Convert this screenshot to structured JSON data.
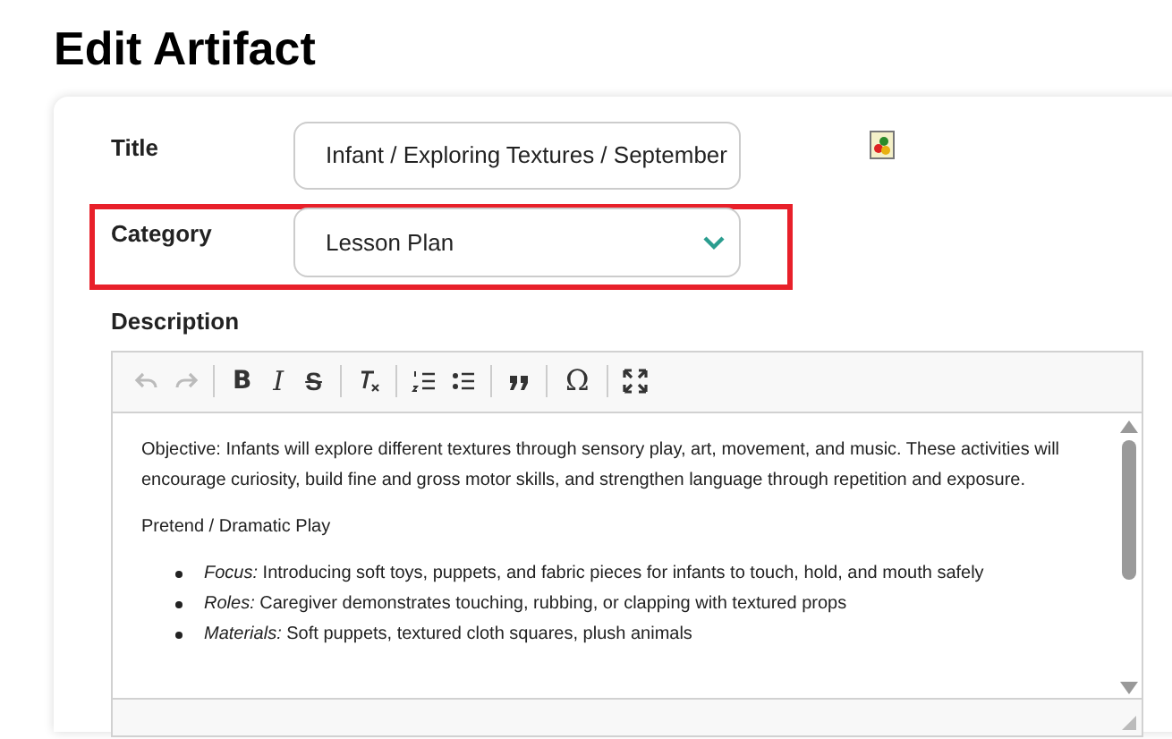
{
  "heading": "Edit Artifact",
  "fields": [
    {
      "kind": "text",
      "label": "Title",
      "value": "Infant / Exploring Textures / September",
      "highlighted": false,
      "attachment_icon": true
    },
    {
      "kind": "select",
      "label": "Category",
      "value": "Lesson Plan",
      "highlighted": true,
      "attachment_icon": false
    }
  ],
  "description": {
    "label": "Description",
    "toolbar": [
      [
        {
          "kind": "icon",
          "disabled": true
        },
        {
          "kind": "icon",
          "disabled": true
        }
      ],
      [
        {
          "kind": "text",
          "text": "B",
          "disabled": false
        },
        {
          "kind": "text",
          "text": "I",
          "disabled": false
        },
        {
          "kind": "text",
          "text": "S",
          "disabled": false
        }
      ],
      [
        {
          "kind": "icon",
          "disabled": false
        }
      ],
      [
        {
          "kind": "icon",
          "disabled": false
        },
        {
          "kind": "icon",
          "disabled": false
        }
      ],
      [
        {
          "kind": "icon",
          "disabled": false
        }
      ],
      [
        {
          "kind": "text",
          "text": "Ω",
          "disabled": false
        }
      ],
      [
        {
          "kind": "icon",
          "disabled": false
        }
      ]
    ],
    "content": [
      {
        "kind": "paragraph",
        "text": "Objective: Infants will explore different textures through sensory play, art, movement, and music. These activities will encourage curiosity, build fine and gross motor skills, and strengthen language through repetition and exposure."
      },
      {
        "kind": "paragraph",
        "text": "Pretend / Dramatic Play"
      },
      {
        "kind": "bullets",
        "items": [
          "*Focus:* Introducing soft toys, puppets, and fabric pieces for infants to touch, hold, and mouth safely",
          "*Roles:* Caregiver demonstrates touching, rubbing, or clapping with textured props",
          "*Materials:* Soft puppets, textured cloth squares, plush animals"
        ]
      }
    ]
  }
}
